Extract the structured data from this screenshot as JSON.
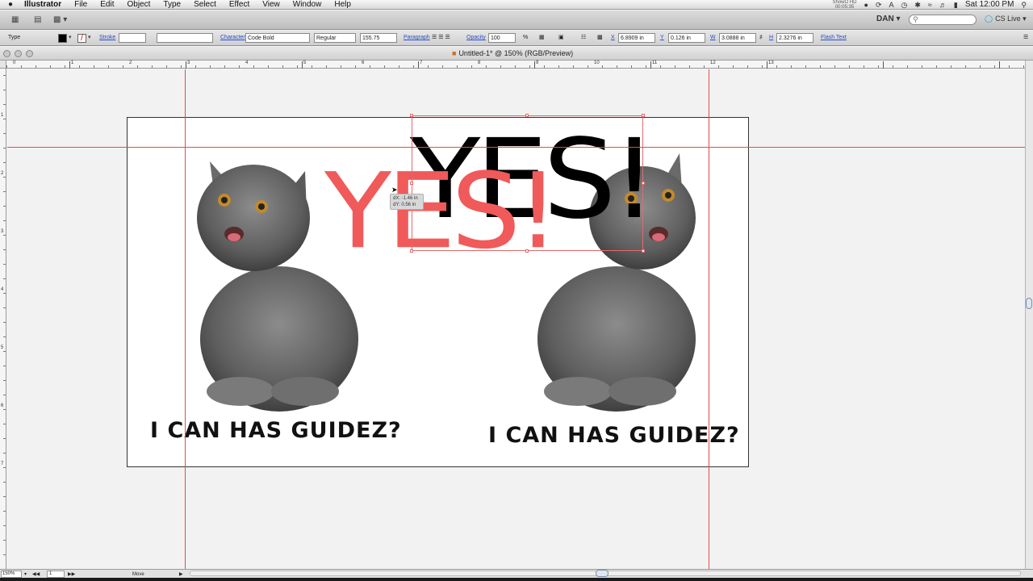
{
  "menubar": {
    "apple": "",
    "app_name": "Illustrator",
    "items": [
      "File",
      "Edit",
      "Object",
      "Type",
      "Select",
      "Effect",
      "View",
      "Window",
      "Help"
    ],
    "recorder_line1": "ShowO HD",
    "recorder_line2": "00:05:35",
    "time": "Sat 12:00 PM"
  },
  "appbar": {
    "user": "DAN",
    "search_placeholder": "",
    "cs_live": "CS Live"
  },
  "control_panel": {
    "tool_label": "Type",
    "stroke_label": "Stroke",
    "character_label": "Character",
    "font_name": "Code Bold",
    "font_style": "Regular",
    "font_size": "155.75",
    "paragraph_label": "Paragraph",
    "opacity_label": "Opacity",
    "opacity_value": "100",
    "percent": "%",
    "x_label": "X",
    "x_value": "6.8909 in",
    "y_label": "Y",
    "y_value": "0.126 in",
    "w_label": "W",
    "w_value": "3.0888 in",
    "h_label": "H",
    "h_value": "2.3276 in",
    "flash_text": "Flash Text"
  },
  "document": {
    "title": "Untitled-1* @ 150% (RGB/Preview)"
  },
  "ruler": {
    "top_numbers": [
      "0",
      "1",
      "2",
      "3",
      "4",
      "5",
      "6",
      "7",
      "8",
      "9",
      "10",
      "11",
      "12",
      "13"
    ],
    "left_numbers": [
      "1",
      "2",
      "3",
      "4",
      "5",
      "6",
      "7"
    ]
  },
  "artwork": {
    "yes_black": "YES!",
    "yes_red": "YES!",
    "caption_left": "I CAN HAS GUIDEZ?",
    "caption_right": "I CAN HAS GUIDEZ?",
    "colors": {
      "red": "#f05a5a",
      "black": "#000000",
      "guide": "#e84a4a"
    }
  },
  "drag_tooltip": {
    "dx": "dX: -1.46 in",
    "dy": "dY: 0.56 in"
  },
  "status": {
    "zoom": "150%",
    "page": "1",
    "tool": "Move"
  }
}
